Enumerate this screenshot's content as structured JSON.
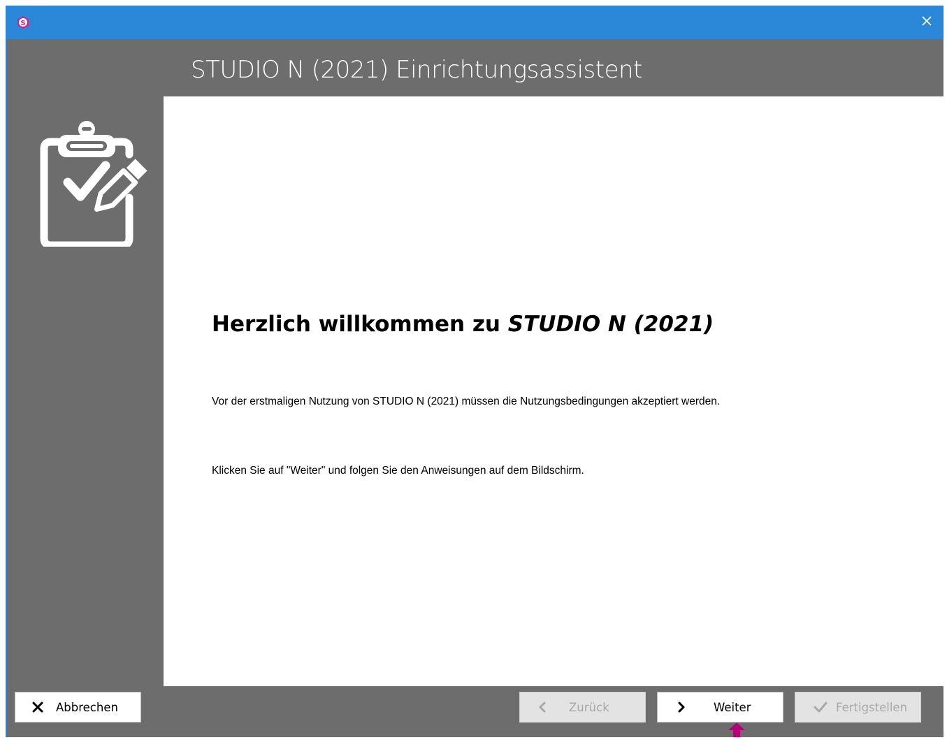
{
  "window": {
    "accent_color": "#2b87d8",
    "panel_color": "#6d6d6d",
    "app_icon": "studio-n-logo-icon",
    "close_icon": "close-icon"
  },
  "header": {
    "title": "STUDIO N (2021) Einrichtungsassistent"
  },
  "sidebar": {
    "icon": "clipboard-check-pencil-icon"
  },
  "content": {
    "welcome_prefix": "Herzlich willkommen zu ",
    "welcome_product": "STUDIO N (2021)",
    "paragraph1": "Vor der erstmaligen Nutzung von STUDIO N (2021) müssen die Nutzungsbedingungen akzeptiert werden.",
    "paragraph2": "Klicken Sie auf \"Weiter\" und folgen Sie den Anweisungen auf dem Bildschirm."
  },
  "footer": {
    "cancel_label": "Abbrechen",
    "back_label": "Zurück",
    "next_label": "Weiter",
    "finish_label": "Fertigstellen",
    "back_enabled": false,
    "finish_enabled": false
  },
  "pointer": {
    "icon": "pointer-arrow-icon",
    "color": "#b5007a"
  }
}
